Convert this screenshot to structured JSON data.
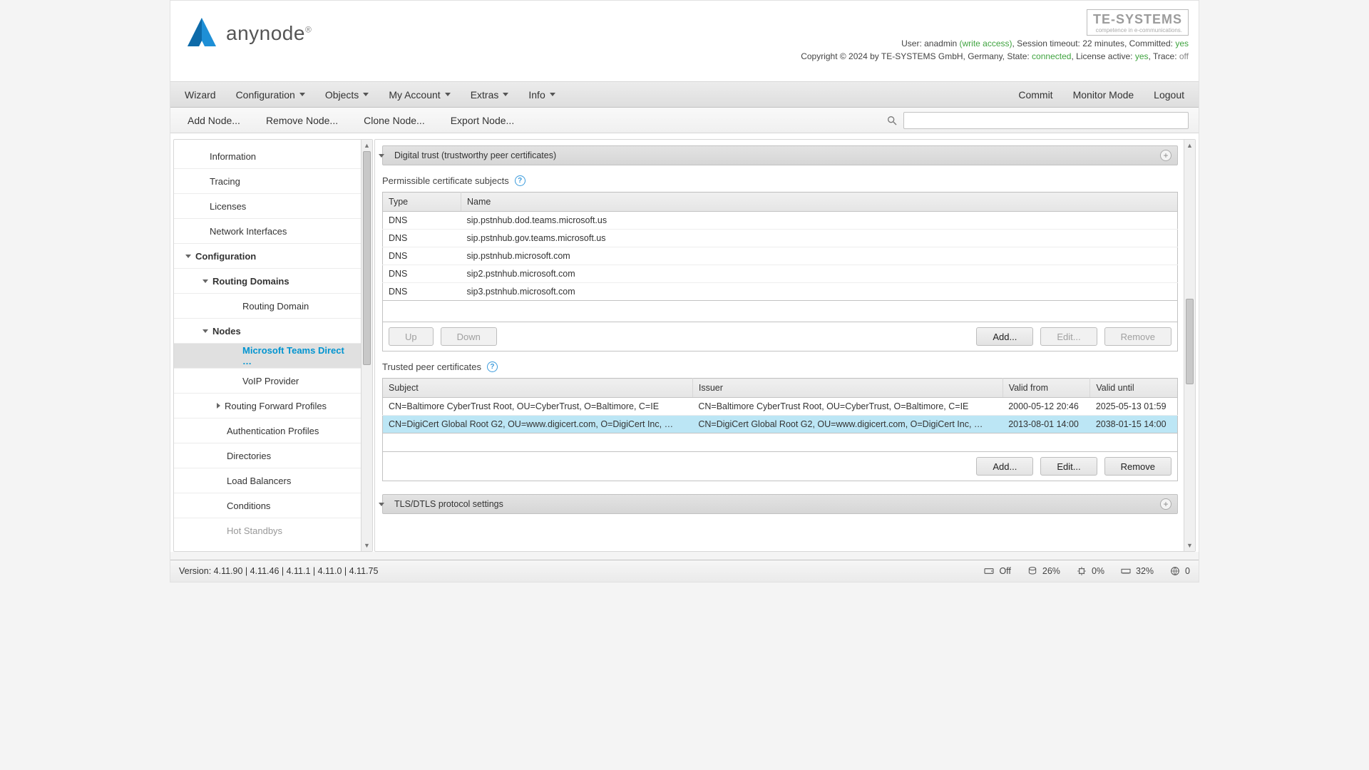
{
  "brand": {
    "name": "anynode",
    "trademark": "®"
  },
  "vendor": {
    "name": "TE-SYSTEMS",
    "tagline": "competence in e-communications."
  },
  "header_status": {
    "user_label": "User:",
    "user": "anadmin",
    "access_label": "(write access)",
    "session_label": ", Session timeout:",
    "session": "22 minutes",
    "committed_label": ", Committed:",
    "committed": "yes",
    "copyright": "Copyright © 2024 by TE-SYSTEMS GmbH, Germany, State:",
    "state": "connected",
    "license_label": ", License active:",
    "license": "yes",
    "trace_label": ", Trace:",
    "trace": "off"
  },
  "menubar": {
    "wizard": "Wizard",
    "configuration": "Configuration",
    "objects": "Objects",
    "my_account": "My Account",
    "extras": "Extras",
    "info": "Info",
    "commit": "Commit",
    "monitor": "Monitor Mode",
    "logout": "Logout"
  },
  "toolbar": {
    "add_node": "Add Node...",
    "remove_node": "Remove Node...",
    "clone_node": "Clone Node...",
    "export_node": "Export Node...",
    "search_placeholder": ""
  },
  "nav": {
    "information": "Information",
    "tracing": "Tracing",
    "licenses": "Licenses",
    "network_interfaces": "Network Interfaces",
    "configuration": "Configuration",
    "routing_domains": "Routing Domains",
    "routing_domain": "Routing Domain",
    "nodes": "Nodes",
    "ms_teams": "Microsoft Teams Direct …",
    "voip_provider": "VoIP Provider",
    "routing_forward": "Routing Forward Profiles",
    "auth_profiles": "Authentication Profiles",
    "directories": "Directories",
    "load_balancers": "Load Balancers",
    "conditions": "Conditions",
    "hot_standbys": "Hot Standbys"
  },
  "content": {
    "section_digital_trust": "Digital trust (trustworthy peer certificates)",
    "subjects_title": "Permissible certificate subjects",
    "subjects_cols": {
      "type": "Type",
      "name": "Name"
    },
    "subjects": [
      {
        "type": "DNS",
        "name": "sip.pstnhub.dod.teams.microsoft.us"
      },
      {
        "type": "DNS",
        "name": "sip.pstnhub.gov.teams.microsoft.us"
      },
      {
        "type": "DNS",
        "name": "sip.pstnhub.microsoft.com"
      },
      {
        "type": "DNS",
        "name": "sip2.pstnhub.microsoft.com"
      },
      {
        "type": "DNS",
        "name": "sip3.pstnhub.microsoft.com"
      }
    ],
    "btn_up": "Up",
    "btn_down": "Down",
    "btn_add": "Add...",
    "btn_edit": "Edit...",
    "btn_remove": "Remove",
    "trusted_title": "Trusted peer certificates",
    "trusted_cols": {
      "subject": "Subject",
      "issuer": "Issuer",
      "from": "Valid from",
      "until": "Valid until"
    },
    "trusted": [
      {
        "subject": "CN=Baltimore CyberTrust Root, OU=CyberTrust, O=Baltimore, C=IE",
        "issuer": "CN=Baltimore CyberTrust Root, OU=CyberTrust, O=Baltimore, C=IE",
        "from": "2000-05-12 20:46",
        "until": "2025-05-13 01:59",
        "selected": false
      },
      {
        "subject": "CN=DigiCert Global Root G2, OU=www.digicert.com, O=DigiCert Inc, …",
        "issuer": "CN=DigiCert Global Root G2, OU=www.digicert.com, O=DigiCert Inc, …",
        "from": "2013-08-01 14:00",
        "until": "2038-01-15 14:00",
        "selected": true
      }
    ],
    "section_tls": "TLS/DTLS protocol settings"
  },
  "footer": {
    "version_label": "Version:",
    "versions": "4.11.90 | 4.11.46 | 4.11.1 | 4.11.0 | 4.11.75",
    "meters": {
      "hdd": "Off",
      "disk": "26%",
      "cpu": "0%",
      "ram": "32%",
      "net": "0"
    }
  }
}
